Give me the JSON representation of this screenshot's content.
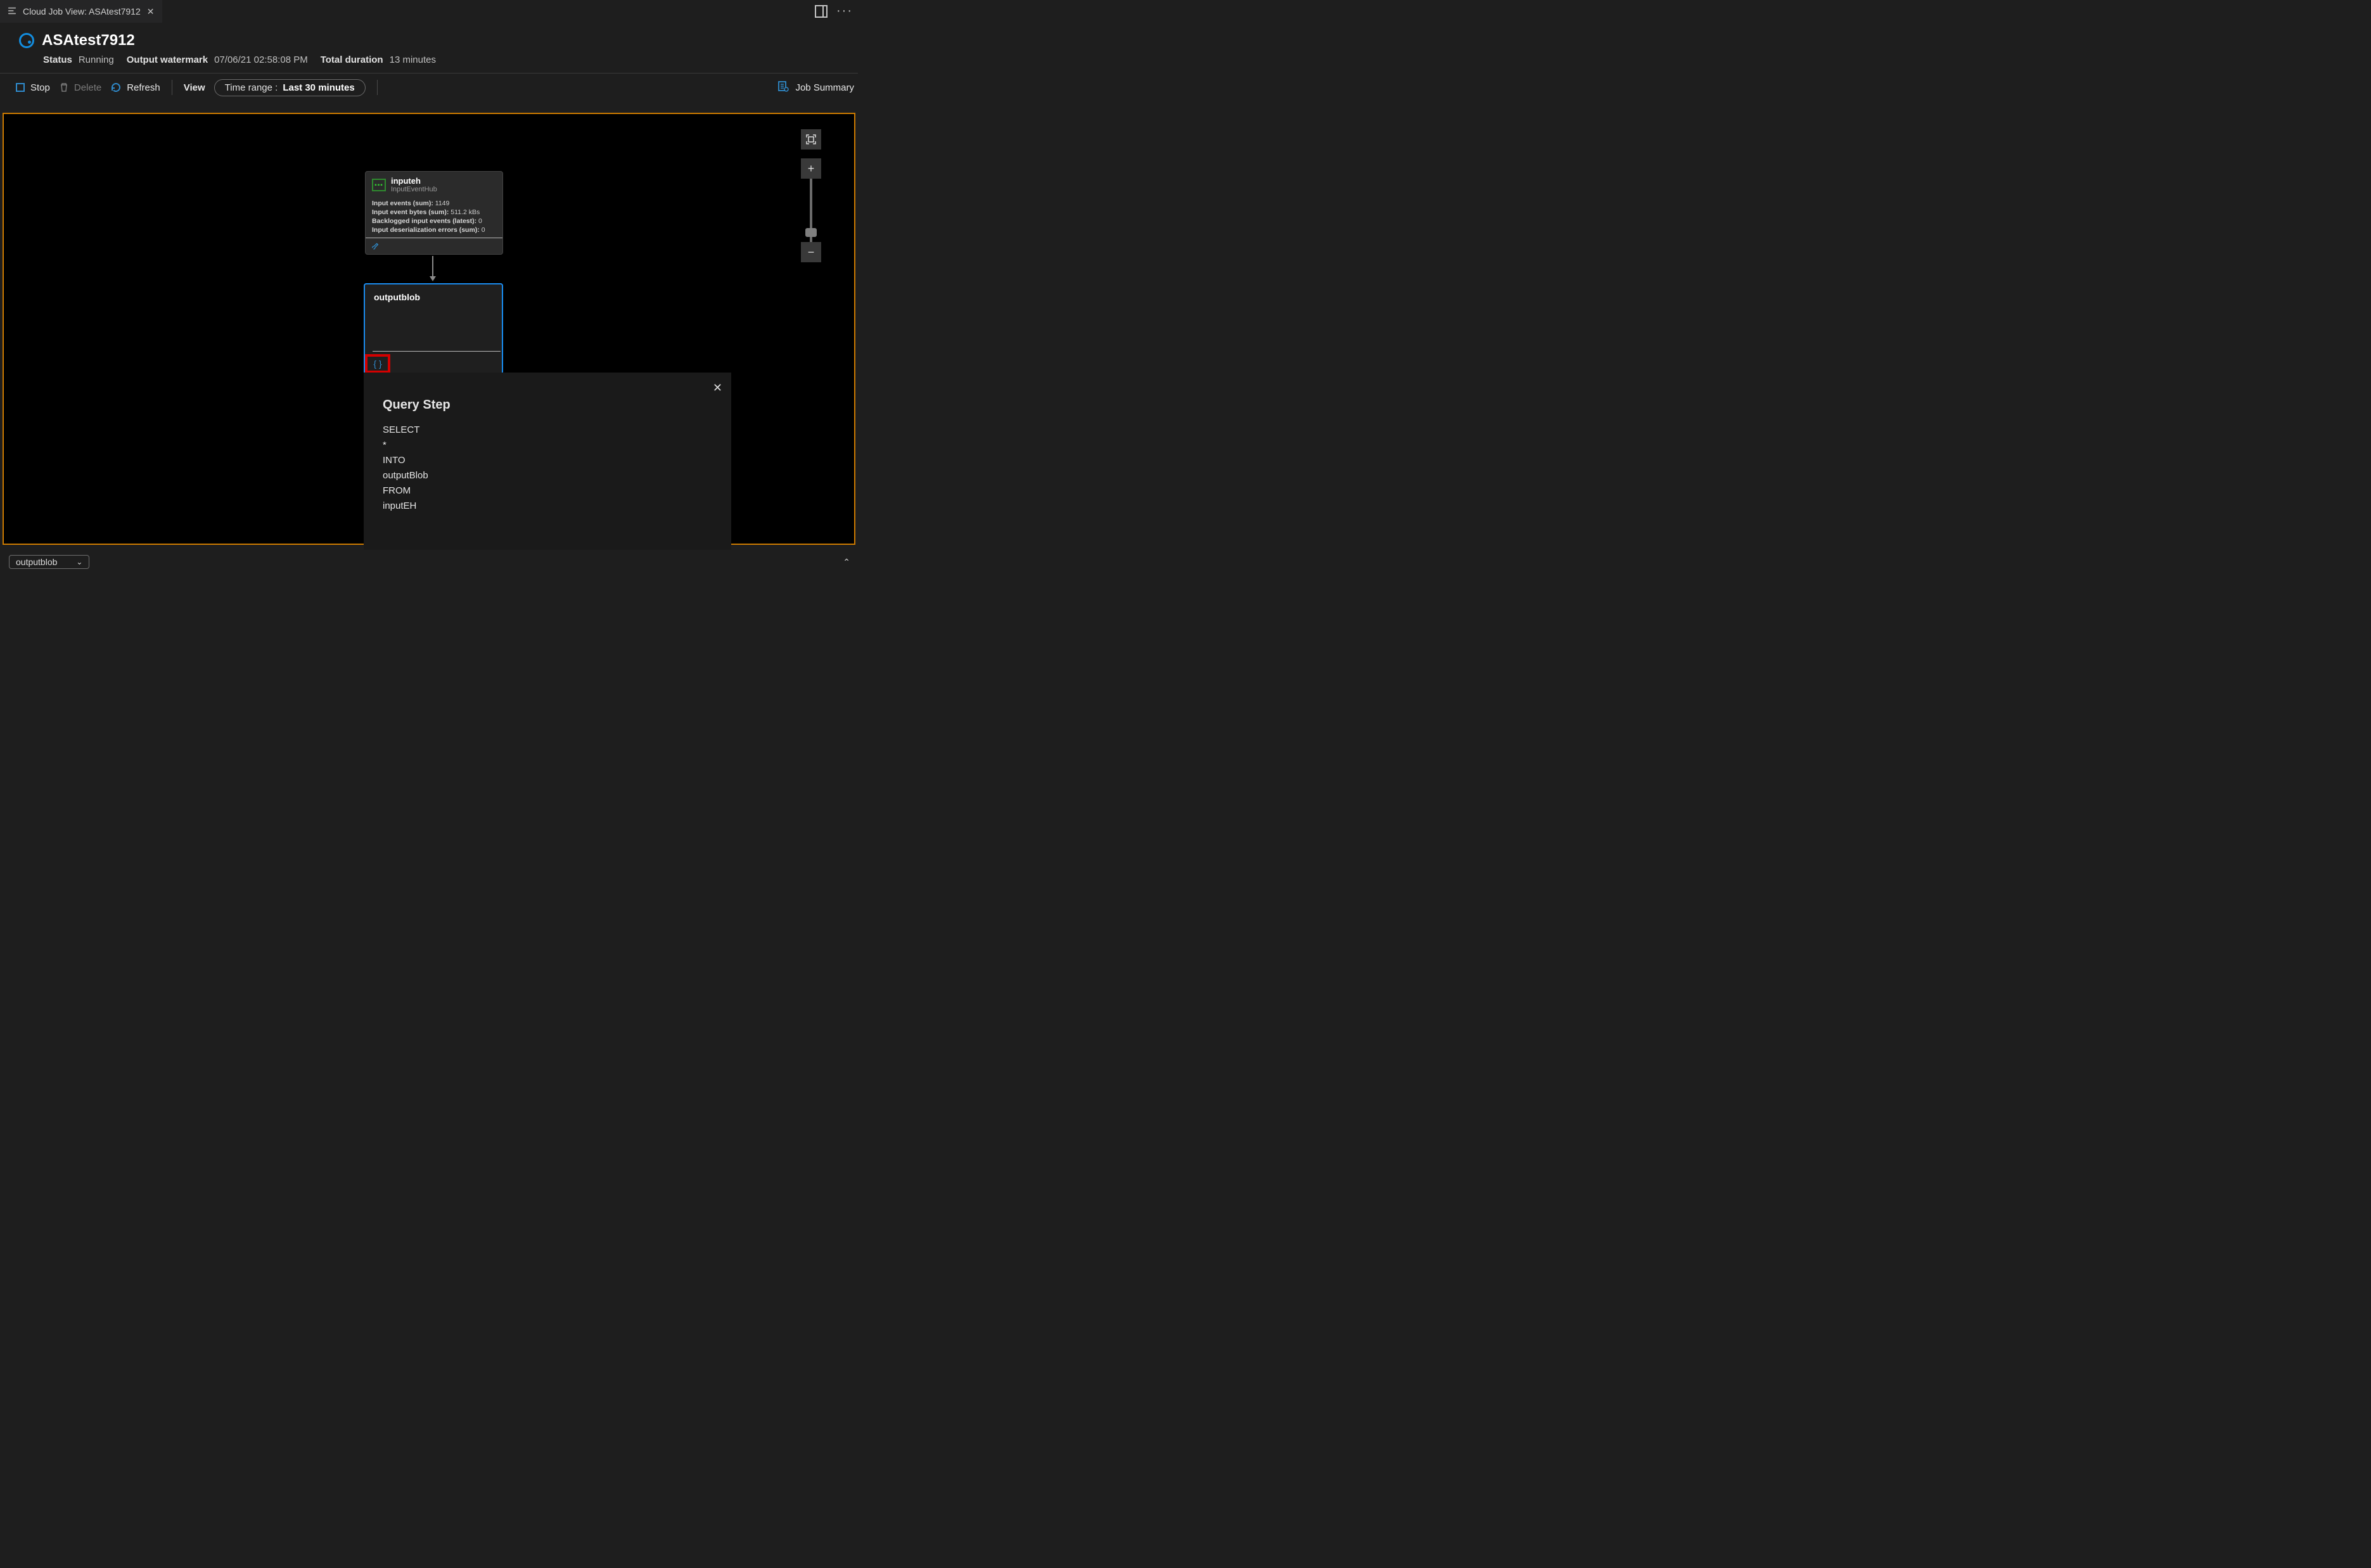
{
  "tab": {
    "title": "Cloud Job View: ASAtest7912"
  },
  "header": {
    "titleIcon": "azure",
    "title": "ASAtest7912",
    "status_label": "Status",
    "status_value": "Running",
    "watermark_label": "Output watermark",
    "watermark_value": "07/06/21 02:58:08 PM",
    "duration_label": "Total duration",
    "duration_value": "13 minutes"
  },
  "toolbar": {
    "stop": "Stop",
    "delete": "Delete",
    "refresh": "Refresh",
    "view": "View",
    "timeRangeLabel": "Time range :",
    "timeRangeValue": "Last 30 minutes",
    "jobSummary": "Job Summary"
  },
  "flow": {
    "input": {
      "name": "inputeh",
      "type": "InputEventHub",
      "metrics": [
        {
          "label": "Input events (sum):",
          "value": "1149"
        },
        {
          "label": "Input event bytes (sum):",
          "value": "511.2 kBs"
        },
        {
          "label": "Backlogged input events (latest):",
          "value": "0"
        },
        {
          "label": "Input deserialization errors (sum):",
          "value": "0"
        }
      ]
    },
    "output": {
      "name": "outputblob",
      "scriptIcon": "{ }"
    }
  },
  "queryStep": {
    "title": "Query Step",
    "lines": [
      "SELECT",
      "*",
      "INTO",
      "outputBlob",
      "FROM",
      "inputEH"
    ]
  },
  "bottom": {
    "dropdown": "outputblob"
  }
}
